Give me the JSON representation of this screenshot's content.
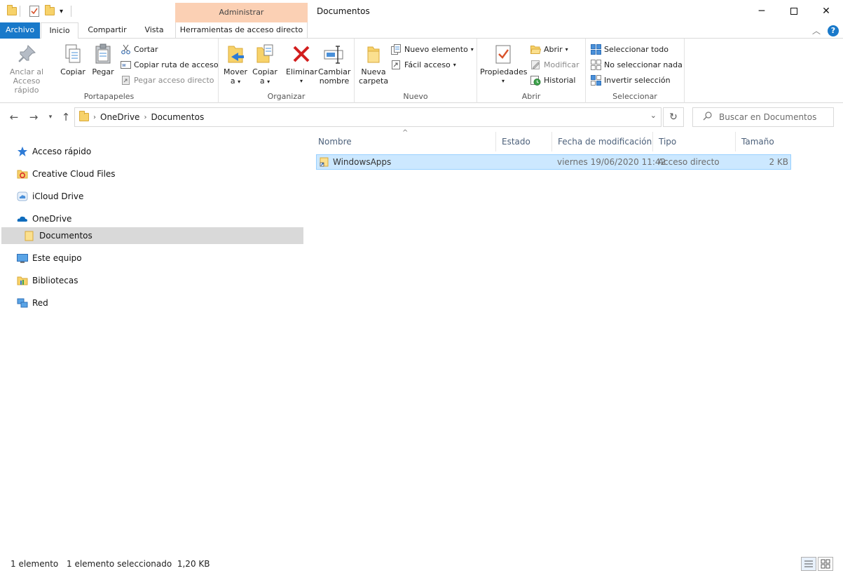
{
  "window": {
    "title": "Documentos",
    "context_tab_header": "Administrar"
  },
  "tabs": {
    "archivo": "Archivo",
    "inicio": "Inicio",
    "compartir": "Compartir",
    "vista": "Vista",
    "herramientas": "Herramientas de acceso directo"
  },
  "ribbon": {
    "portapapeles": {
      "label": "Portapapeles",
      "anclar": [
        "Anclar al",
        "Acceso rápido"
      ],
      "copiar": "Copiar",
      "pegar": "Pegar",
      "cortar": "Cortar",
      "copiar_ruta": "Copiar ruta de acceso",
      "pegar_acceso": "Pegar acceso directo"
    },
    "organizar": {
      "label": "Organizar",
      "mover": [
        "Mover",
        "a"
      ],
      "copiar": [
        "Copiar",
        "a"
      ],
      "eliminar": "Eliminar",
      "cambiar": [
        "Cambiar",
        "nombre"
      ]
    },
    "nuevo": {
      "label": "Nuevo",
      "nueva_carpeta": [
        "Nueva",
        "carpeta"
      ],
      "nuevo_elemento": "Nuevo elemento",
      "facil_acceso": "Fácil acceso"
    },
    "abrir": {
      "label": "Abrir",
      "propiedades": "Propiedades",
      "abrir": "Abrir",
      "modificar": "Modificar",
      "historial": "Historial"
    },
    "seleccionar": {
      "label": "Seleccionar",
      "todo": "Seleccionar todo",
      "nada": "No seleccionar nada",
      "invertir": "Invertir selección"
    }
  },
  "address": {
    "path": [
      "OneDrive",
      "Documentos"
    ],
    "search_placeholder": "Buscar en Documentos"
  },
  "nav": {
    "items": [
      "Acceso rápido",
      "Creative Cloud Files",
      "iCloud Drive",
      "OneDrive",
      "Documentos",
      "Este equipo",
      "Bibliotecas",
      "Red"
    ]
  },
  "columns": [
    "Nombre",
    "Estado",
    "Fecha de modificación",
    "Tipo",
    "Tamaño"
  ],
  "files": [
    {
      "name": "WindowsApps",
      "status": "",
      "modified": "viernes 19/06/2020 11:42",
      "type": "Acceso directo",
      "size": "2 KB"
    }
  ],
  "status": {
    "count": "1 elemento",
    "selection": "1 elemento seleccionado  1,20 KB"
  },
  "colors": {
    "accent": "#1979ca",
    "context_tab": "#fbd0b4",
    "selection": "#cce8ff",
    "folder": "#f7d26a"
  }
}
